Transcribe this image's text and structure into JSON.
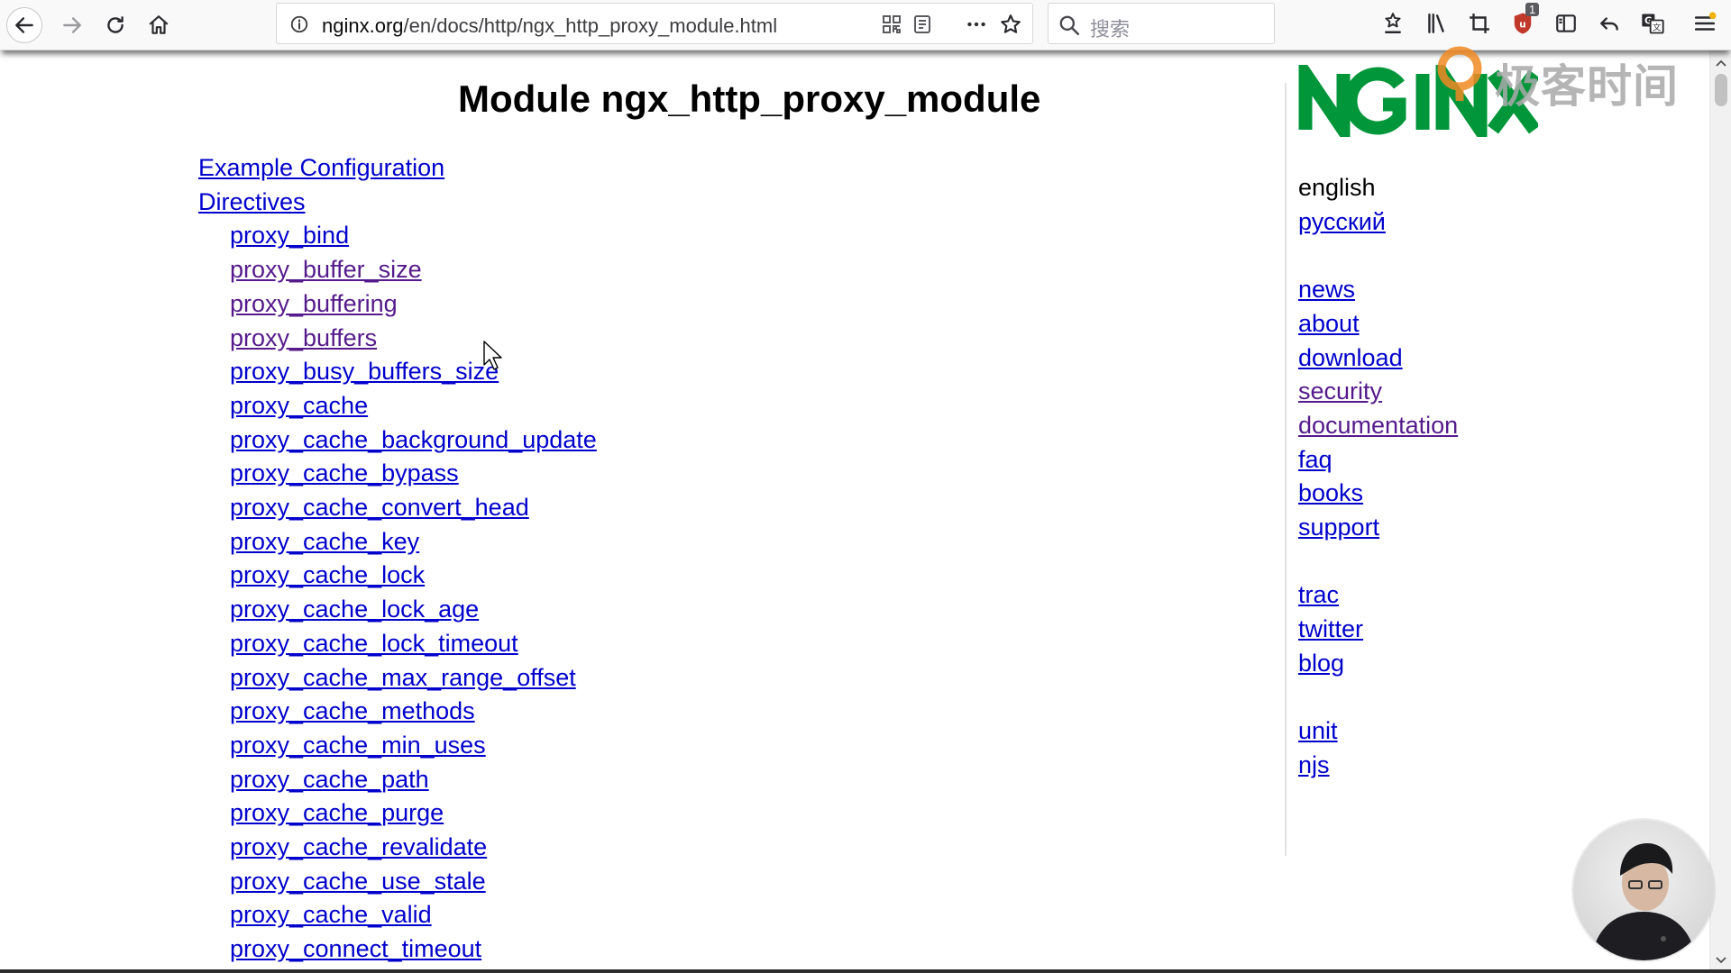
{
  "browser": {
    "url_host": "nginx.org",
    "url_path": "/en/docs/http/ngx_http_proxy_module.html",
    "search_placeholder": "搜索",
    "badge_count": "1"
  },
  "page": {
    "title": "Module ngx_http_proxy_module",
    "toc_top": [
      {
        "label": "Example Configuration"
      },
      {
        "label": "Directives"
      }
    ],
    "directives": [
      {
        "label": "proxy_bind",
        "visited": false
      },
      {
        "label": "proxy_buffer_size",
        "visited": true
      },
      {
        "label": "proxy_buffering",
        "visited": true
      },
      {
        "label": "proxy_buffers",
        "visited": true
      },
      {
        "label": "proxy_busy_buffers_size",
        "visited": false
      },
      {
        "label": "proxy_cache",
        "visited": false
      },
      {
        "label": "proxy_cache_background_update",
        "visited": false
      },
      {
        "label": "proxy_cache_bypass",
        "visited": false
      },
      {
        "label": "proxy_cache_convert_head",
        "visited": false
      },
      {
        "label": "proxy_cache_key",
        "visited": false
      },
      {
        "label": "proxy_cache_lock",
        "visited": false
      },
      {
        "label": "proxy_cache_lock_age",
        "visited": false
      },
      {
        "label": "proxy_cache_lock_timeout",
        "visited": false
      },
      {
        "label": "proxy_cache_max_range_offset",
        "visited": false
      },
      {
        "label": "proxy_cache_methods",
        "visited": false
      },
      {
        "label": "proxy_cache_min_uses",
        "visited": false
      },
      {
        "label": "proxy_cache_path",
        "visited": false
      },
      {
        "label": "proxy_cache_purge",
        "visited": false
      },
      {
        "label": "proxy_cache_revalidate",
        "visited": false
      },
      {
        "label": "proxy_cache_use_stale",
        "visited": false
      },
      {
        "label": "proxy_cache_valid",
        "visited": false
      },
      {
        "label": "proxy_connect_timeout",
        "visited": false
      }
    ]
  },
  "sidebar": {
    "logo_text": "NGINX",
    "languages": {
      "current": "english",
      "other": "русский"
    },
    "groups": [
      [
        {
          "label": "news",
          "visited": false
        },
        {
          "label": "about",
          "visited": false
        },
        {
          "label": "download",
          "visited": false
        },
        {
          "label": "security",
          "visited": true
        },
        {
          "label": "documentation",
          "visited": true
        },
        {
          "label": "faq",
          "visited": false
        },
        {
          "label": "books",
          "visited": false
        },
        {
          "label": "support",
          "visited": false
        }
      ],
      [
        {
          "label": "trac",
          "visited": false
        },
        {
          "label": "twitter",
          "visited": false
        },
        {
          "label": "blog",
          "visited": false
        }
      ],
      [
        {
          "label": "unit",
          "visited": false
        },
        {
          "label": "njs",
          "visited": false
        }
      ]
    ]
  },
  "overlay": {
    "watermark_text": "极客时间"
  },
  "colors": {
    "link": "#0000cc",
    "visited_link": "#551a8b",
    "nginx_green": "#009639",
    "ublock_red": "#c0392b"
  },
  "icons": {
    "back": "arrow-left-icon",
    "forward": "arrow-right-icon",
    "reload": "reload-icon",
    "home": "home-icon",
    "site_info": "info-icon",
    "qr": "qr-code-icon",
    "reader": "reader-view-icon",
    "more": "ellipsis-icon",
    "bookmark": "star-icon",
    "search": "search-icon",
    "downloads": "download-star-icon",
    "library": "library-icon",
    "crop": "crop-icon",
    "ublock": "ublock-shield-icon",
    "sidebar": "sidebar-icon",
    "undo": "undo-icon",
    "translate": "translate-icon",
    "menu": "hamburger-menu-icon"
  }
}
